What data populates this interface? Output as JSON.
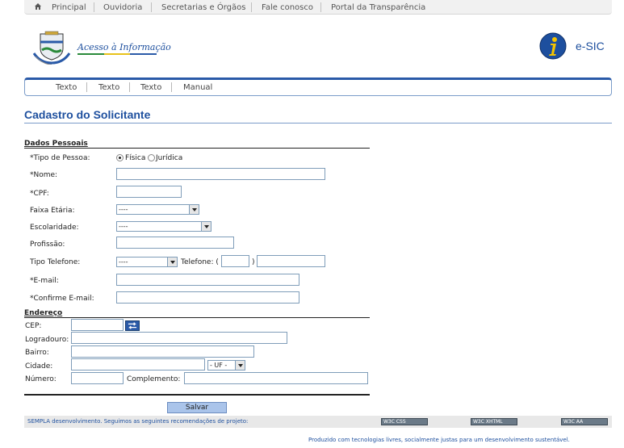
{
  "top_menu": {
    "items": [
      "Principal",
      "Ouvidoria",
      "Secretarias e Órgãos",
      "Fale conosco",
      "Portal da Transparência"
    ]
  },
  "brand": {
    "acesso_label": "Acesso à Informação",
    "esic_label": "e-SIC"
  },
  "sub_menu": {
    "items": [
      "Texto",
      "Texto",
      "Texto",
      "Manual"
    ]
  },
  "page": {
    "title": "Cadastro do Solicitante"
  },
  "dados_pessoais": {
    "heading": "Dados Pessoais",
    "tipo_pessoa_label": "*Tipo de Pessoa:",
    "tipo_pessoa_options": [
      "Física",
      "Jurídica"
    ],
    "tipo_pessoa_selected": "Física",
    "nome_label": "*Nome:",
    "cpf_label": "*CPF:",
    "faixa_etaria_label": "Faixa Etária:",
    "faixa_etaria_value": "----",
    "escolaridade_label": "Escolaridade:",
    "escolaridade_value": "----",
    "profissao_label": "Profissão:",
    "tipo_telefone_label": "Tipo Telefone:",
    "tipo_telefone_value": "----",
    "telefone_label": "Telefone: (",
    "telefone_close": ")",
    "email_label": "*E-mail:",
    "confirme_email_label": "*Confirme E-mail:"
  },
  "endereco": {
    "heading": "Endereço",
    "cep_label": "CEP:",
    "logradouro_label": "Logradouro:",
    "bairro_label": "Bairro:",
    "cidade_label": "Cidade:",
    "uf_value": "- UF -",
    "numero_label": "Número:",
    "complemento_label": "Complemento:"
  },
  "actions": {
    "save_label": "Salvar"
  },
  "footer": {
    "text": "SEMPLA desenvolvimento. Seguimos as seguintes recomendações de projeto:",
    "badges": [
      "W3C CSS",
      "W3C XHTML",
      "W3C AA"
    ],
    "bottom_text": "Produzido com tecnologias livres, socialmente justas para um desenvolvimento sustentável."
  },
  "colors": {
    "brand_blue": "#1d4f9e",
    "button_blue": "#aac4ea"
  }
}
